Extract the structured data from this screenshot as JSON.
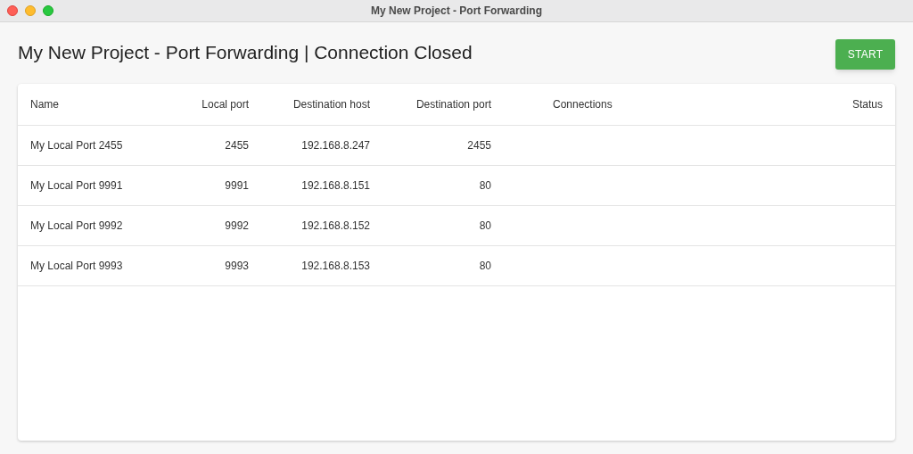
{
  "window": {
    "title": "My New Project - Port Forwarding"
  },
  "heading": "My New Project - Port Forwarding | Connection Closed",
  "start_button": "START",
  "table": {
    "columns": [
      "Name",
      "Local port",
      "Destination host",
      "Destination port",
      "Connections",
      "Status"
    ],
    "rows": [
      [
        "My Local Port 2455",
        "2455",
        "192.168.8.247",
        "2455"
      ],
      [
        "My Local Port 9991",
        "9991",
        "192.168.8.151",
        "80"
      ],
      [
        "My Local Port 9992",
        "9992",
        "192.168.8.152",
        "80"
      ],
      [
        "My Local Port 9993",
        "9993",
        "192.168.8.153",
        "80"
      ]
    ]
  }
}
